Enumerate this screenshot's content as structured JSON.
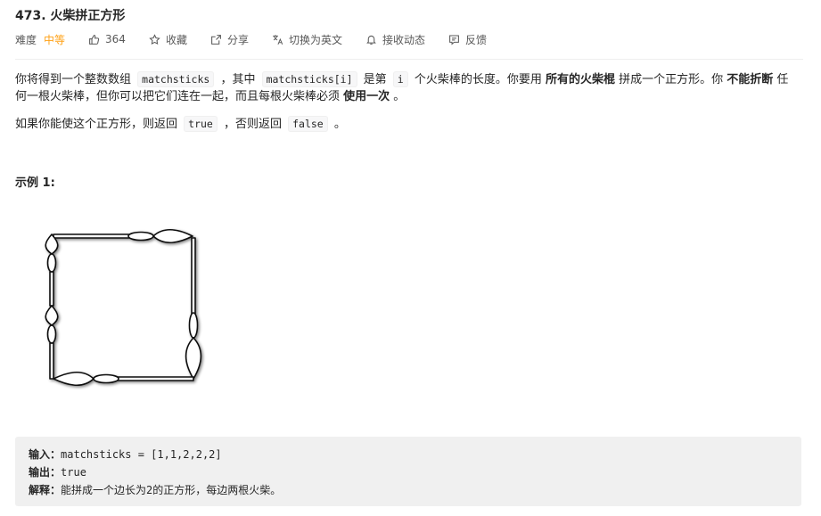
{
  "problem": {
    "title": "473. 火柴拼正方形"
  },
  "meta": {
    "difficulty_label": "难度",
    "difficulty_value": "中等",
    "like_count": "364",
    "collect_label": "收藏",
    "share_label": "分享",
    "translate_label": "切换为英文",
    "notify_label": "接收动态",
    "feedback_label": "反馈",
    "icons": [
      "thumbs-up-icon",
      "star-icon",
      "share-icon",
      "translate-icon",
      "bell-icon",
      "feedback-icon"
    ],
    "colors": {
      "difficulty": "#ffa116"
    }
  },
  "description": {
    "p1": {
      "t1": "你将得到一个整数数组 ",
      "c1": "matchsticks",
      "t2": " ，其中 ",
      "c2": "matchsticks[i]",
      "t3": " 是第 ",
      "c3": "i",
      "t4": " 个火柴棒的长度。你要用 ",
      "b1": "所有的火柴棍",
      "t5": " 拼成一个正方形。你 ",
      "b2": "不能折断",
      "t6": " 任何一根火柴棒，但你可以把它们连在一起，而且每根火柴棒必须 ",
      "b3": "使用一次",
      "t7": " 。"
    },
    "p2": {
      "t1": "如果你能使这个正方形，则返回 ",
      "c1": "true",
      "t2": " ，否则返回 ",
      "c2": "false",
      "t3": " 。"
    }
  },
  "example": {
    "title": "示例 1:",
    "input_label": "输入：",
    "input_value": "matchsticks = [1,1,2,2,2]",
    "output_label": "输出：",
    "output_value": "true",
    "explain_label": "解释：",
    "explain_value": "能拼成一个边长为2的正方形，每边两根火柴。"
  }
}
